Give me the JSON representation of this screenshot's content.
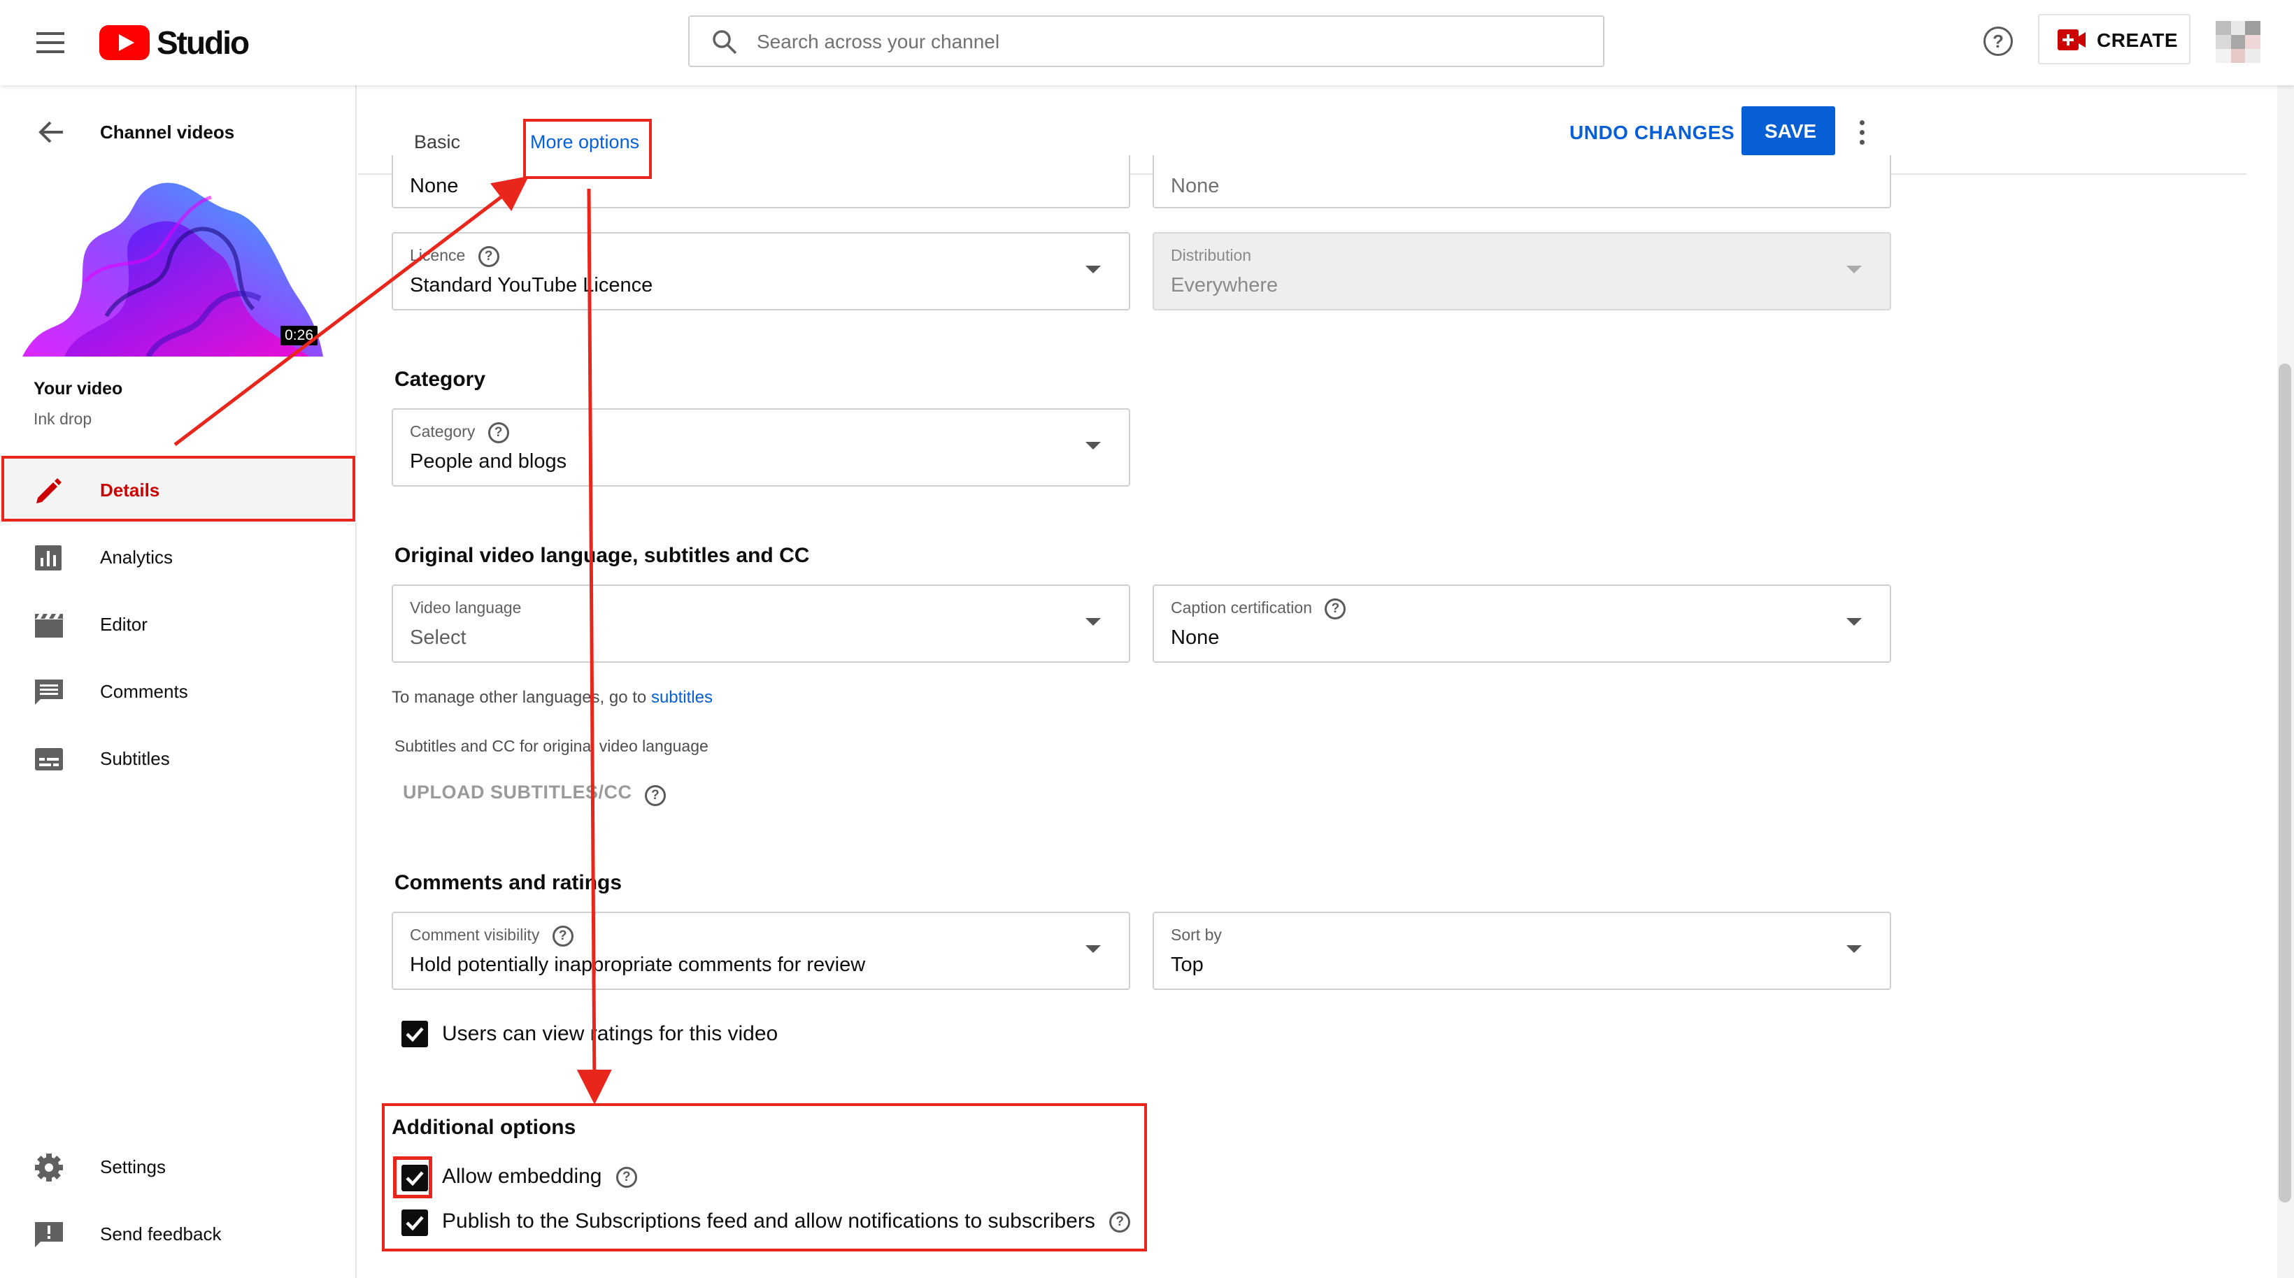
{
  "app": {
    "name": "Studio"
  },
  "search": {
    "placeholder": "Search across your channel"
  },
  "header": {
    "create_label": "CREATE"
  },
  "sidebar": {
    "back_label": "Channel videos",
    "thumbnail_duration": "0:26",
    "video_heading": "Your video",
    "video_name": "Ink drop",
    "items": [
      {
        "label": "Details",
        "icon": "pencil-icon",
        "active": true
      },
      {
        "label": "Analytics",
        "icon": "analytics-icon"
      },
      {
        "label": "Editor",
        "icon": "clapperboard-icon"
      },
      {
        "label": "Comments",
        "icon": "comment-icon"
      },
      {
        "label": "Subtitles",
        "icon": "subtitles-icon"
      }
    ],
    "bottom_items": [
      {
        "label": "Settings",
        "icon": "gear-icon"
      },
      {
        "label": "Send feedback",
        "icon": "feedback-icon"
      }
    ]
  },
  "tabs": {
    "basic": "Basic",
    "more_options": "More options"
  },
  "actions": {
    "undo": "UNDO CHANGES",
    "save": "SAVE"
  },
  "fields": {
    "top_left_value": "None",
    "top_right_value": "None",
    "licence": {
      "label": "Licence",
      "value": "Standard YouTube Licence"
    },
    "distribution": {
      "label": "Distribution",
      "value": "Everywhere"
    },
    "category": {
      "label": "Category",
      "value": "People and blogs"
    },
    "video_language": {
      "label": "Video language",
      "value": "Select"
    },
    "caption_certification": {
      "label": "Caption certification",
      "value": "None"
    },
    "comment_visibility": {
      "label": "Comment visibility",
      "value": "Hold potentially inappropriate comments for review"
    },
    "sort_by": {
      "label": "Sort by",
      "value": "Top"
    }
  },
  "sections": {
    "category": "Category",
    "language": "Original video language, subtitles and CC",
    "comments": "Comments and ratings",
    "additional": "Additional options"
  },
  "language_note": {
    "prefix": "To manage other languages, go to ",
    "link": "subtitles"
  },
  "subtitles_note": "Subtitles and CC for original video language",
  "upload_subtitles": "UPLOAD SUBTITLES/CC",
  "checkboxes": {
    "ratings": "Users can view ratings for this video",
    "embedding": "Allow embedding",
    "publish_feed": "Publish to the Subscriptions feed and allow notifications to subscribers"
  },
  "colors": {
    "brand_red": "#ff0000",
    "accent_blue": "#065fd4",
    "annotation_red": "#e8261c"
  }
}
